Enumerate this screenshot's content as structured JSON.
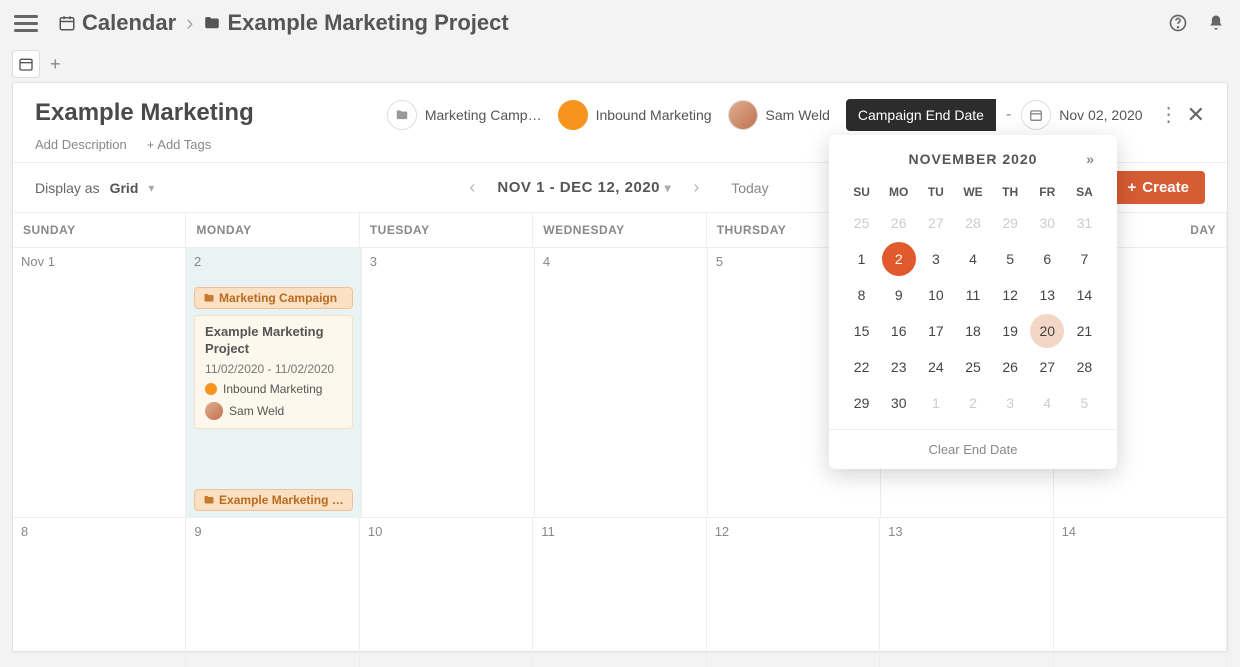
{
  "breadcrumbs": {
    "root": "Calendar",
    "project": "Example Marketing Project"
  },
  "panel": {
    "title": "Example Marketing",
    "add_description": "Add Description",
    "add_tags": "+ Add Tags",
    "campaign_label": "Marketing Camp…",
    "inbound_label": "Inbound Marketing",
    "user_label": "Sam Weld",
    "end_date_tag": "Campaign End Date",
    "dash": "-",
    "end_date_value": "Nov 02, 2020"
  },
  "toolbar": {
    "display_as_label": "Display as",
    "display_as_value": "Grid",
    "range": "NOV 1 - DEC 12, 2020",
    "today": "Today",
    "create": "Create"
  },
  "dayheads": [
    "SUNDAY",
    "MONDAY",
    "TUESDAY",
    "WEDNESDAY",
    "THURSDAY",
    "",
    "DAY"
  ],
  "week1": [
    "Nov 1",
    "2",
    "3",
    "4",
    "5",
    "",
    "",
    ""
  ],
  "week2": [
    "8",
    "9",
    "10",
    "11",
    "12",
    "13",
    "14"
  ],
  "event": {
    "folder1": "Marketing Campaign",
    "card_title": "Example Marketing Project",
    "card_dates": "11/02/2020 - 11/02/2020",
    "card_tag": "Inbound Marketing",
    "card_user": "Sam Weld",
    "folder2": "Example Marketing …"
  },
  "datepicker": {
    "title": "NOVEMBER 2020",
    "next": "»",
    "dow": [
      "SU",
      "MO",
      "TU",
      "WE",
      "TH",
      "FR",
      "SA"
    ],
    "rows": [
      [
        {
          "n": "25",
          "m": 1
        },
        {
          "n": "26",
          "m": 1
        },
        {
          "n": "27",
          "m": 1
        },
        {
          "n": "28",
          "m": 1
        },
        {
          "n": "29",
          "m": 1
        },
        {
          "n": "30",
          "m": 1
        },
        {
          "n": "31",
          "m": 1
        }
      ],
      [
        {
          "n": "1"
        },
        {
          "n": "2",
          "sel": 1
        },
        {
          "n": "3"
        },
        {
          "n": "4"
        },
        {
          "n": "5"
        },
        {
          "n": "6"
        },
        {
          "n": "7"
        }
      ],
      [
        {
          "n": "8"
        },
        {
          "n": "9"
        },
        {
          "n": "10"
        },
        {
          "n": "11"
        },
        {
          "n": "12"
        },
        {
          "n": "13"
        },
        {
          "n": "14"
        }
      ],
      [
        {
          "n": "15"
        },
        {
          "n": "16"
        },
        {
          "n": "17"
        },
        {
          "n": "18"
        },
        {
          "n": "19"
        },
        {
          "n": "20",
          "hov": 1
        },
        {
          "n": "21"
        }
      ],
      [
        {
          "n": "22"
        },
        {
          "n": "23"
        },
        {
          "n": "24"
        },
        {
          "n": "25"
        },
        {
          "n": "26"
        },
        {
          "n": "27"
        },
        {
          "n": "28"
        }
      ],
      [
        {
          "n": "29"
        },
        {
          "n": "30"
        },
        {
          "n": "1",
          "m": 1
        },
        {
          "n": "2",
          "m": 1
        },
        {
          "n": "3",
          "m": 1
        },
        {
          "n": "4",
          "m": 1
        },
        {
          "n": "5",
          "m": 1
        }
      ]
    ],
    "clear": "Clear End Date"
  }
}
